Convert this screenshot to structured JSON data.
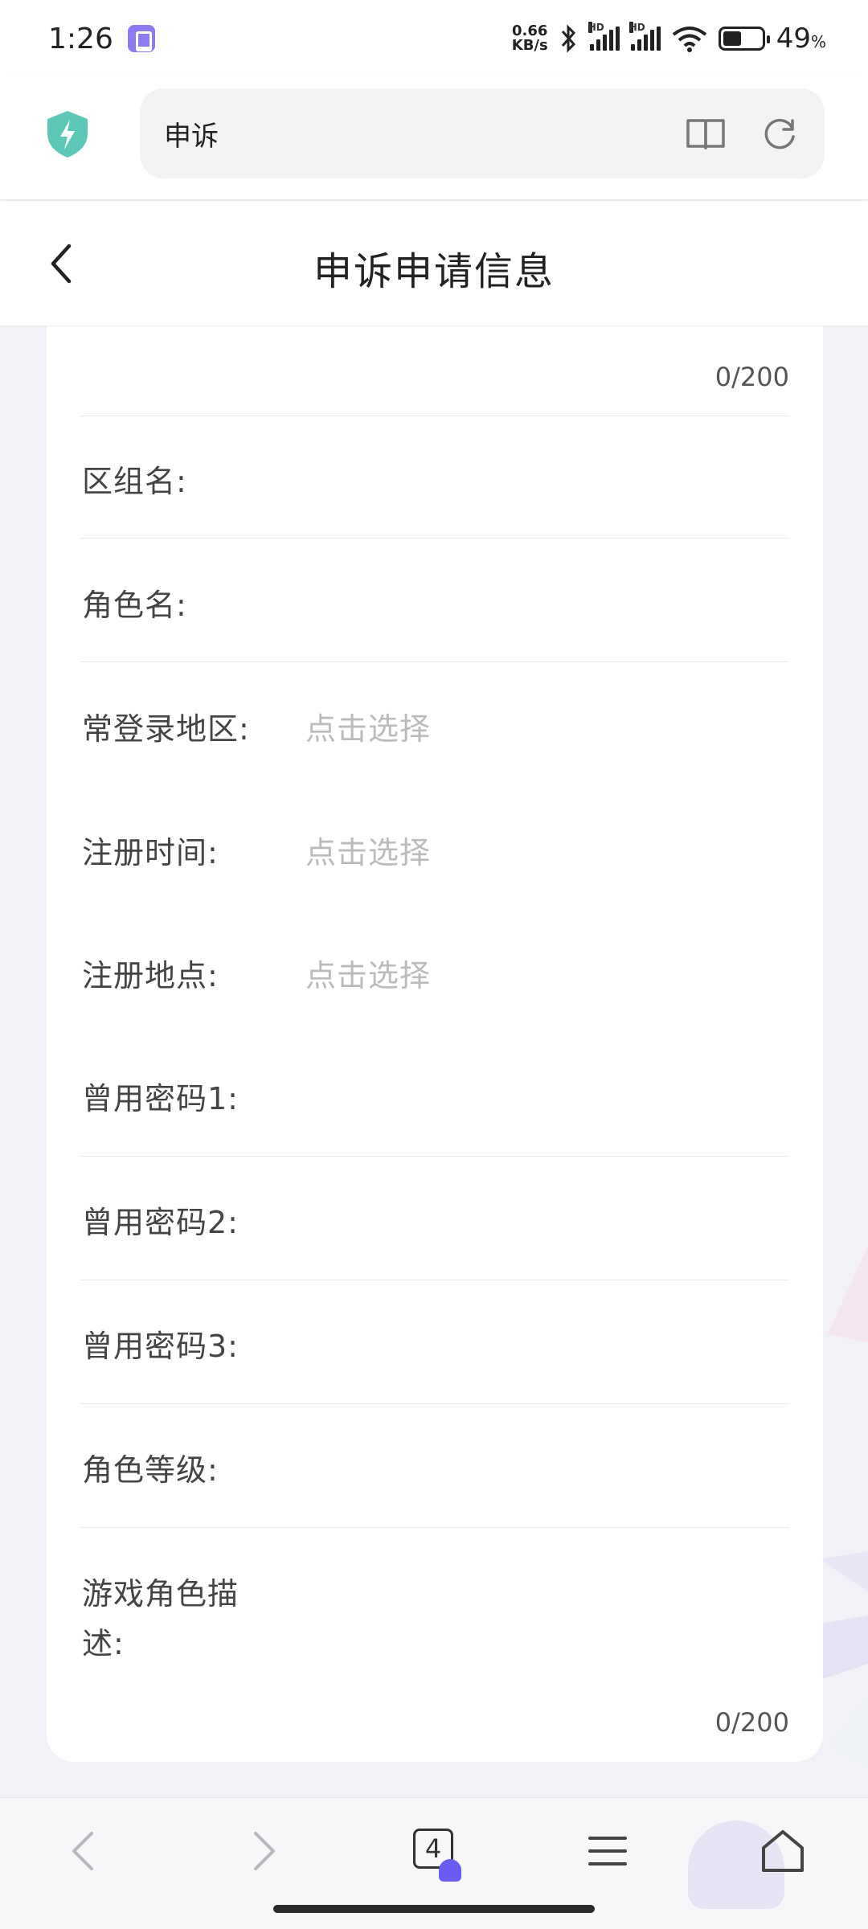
{
  "status_bar": {
    "time": "1:26",
    "net_speed_value": "0.66",
    "net_speed_unit": "KB/s",
    "sim1_label": "HD",
    "sim2_label": "HD",
    "battery_percent": "49",
    "battery_unit": "%"
  },
  "browser": {
    "address_text": "申诉",
    "shield_color": "#5ec8b8",
    "tab_count": "4"
  },
  "page": {
    "title": "申诉申请信息"
  },
  "form": {
    "top_counter": "0/200",
    "fields": [
      {
        "label": "区组名:"
      },
      {
        "label": "角色名:"
      },
      {
        "label": "常登录地区:",
        "placeholder": "点击选择"
      },
      {
        "label": "注册时间:",
        "placeholder": "点击选择"
      },
      {
        "label": "注册地点:",
        "placeholder": "点击选择"
      },
      {
        "label": "曾用密码1:"
      },
      {
        "label": "曾用密码2:"
      },
      {
        "label": "曾用密码3:"
      },
      {
        "label": "角色等级:"
      },
      {
        "label_line1": "游戏角色描",
        "label_line2": "述:"
      }
    ],
    "bottom_counter": "0/200"
  },
  "icons": {
    "shield": "shield-bolt-icon",
    "reader": "book-icon",
    "refresh": "refresh-icon",
    "back": "chevron-left-icon",
    "nav_back": "arrow-left-icon",
    "nav_forward": "arrow-right-icon",
    "tabs": "tabs-icon",
    "menu": "menu-icon",
    "home": "home-icon"
  },
  "colors": {
    "accent": "#6a5cf2",
    "placeholder": "#bbbbbb",
    "background": "#f2f1f7"
  }
}
